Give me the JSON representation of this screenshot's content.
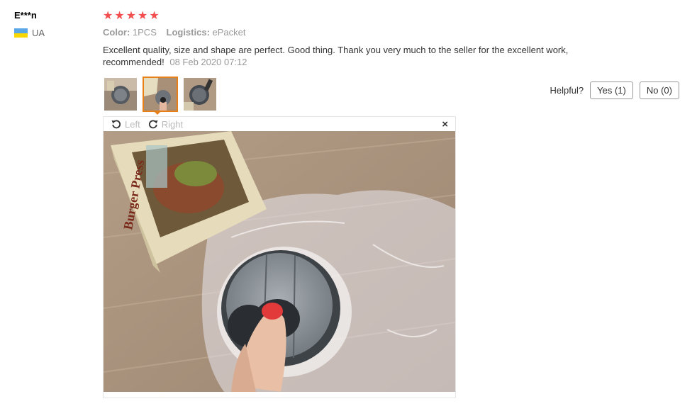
{
  "user": {
    "name": "E***n",
    "country": "UA"
  },
  "rating": {
    "stars": 5,
    "max": 5
  },
  "attributes": {
    "color_label": "Color:",
    "color_value": "1PCS",
    "logistics_label": "Logistics:",
    "logistics_value": "ePacket"
  },
  "review": {
    "text": "Excellent quality, size and shape are perfect. Good thing. Thank you very much to the seller for the excellent work, recommended!",
    "date": "08 Feb 2020 07:12"
  },
  "helpful": {
    "label": "Helpful?",
    "yes": "Yes (1)",
    "no": "No (0)"
  },
  "viewer": {
    "left_label": "Left",
    "right_label": "Right",
    "close": "×"
  },
  "photo": {
    "box_text": "Burger Press"
  },
  "colors": {
    "star": "#f44d4d",
    "active_border": "#e8801a",
    "flag_top": "#4a90e2",
    "flag_bottom": "#f8d800"
  }
}
